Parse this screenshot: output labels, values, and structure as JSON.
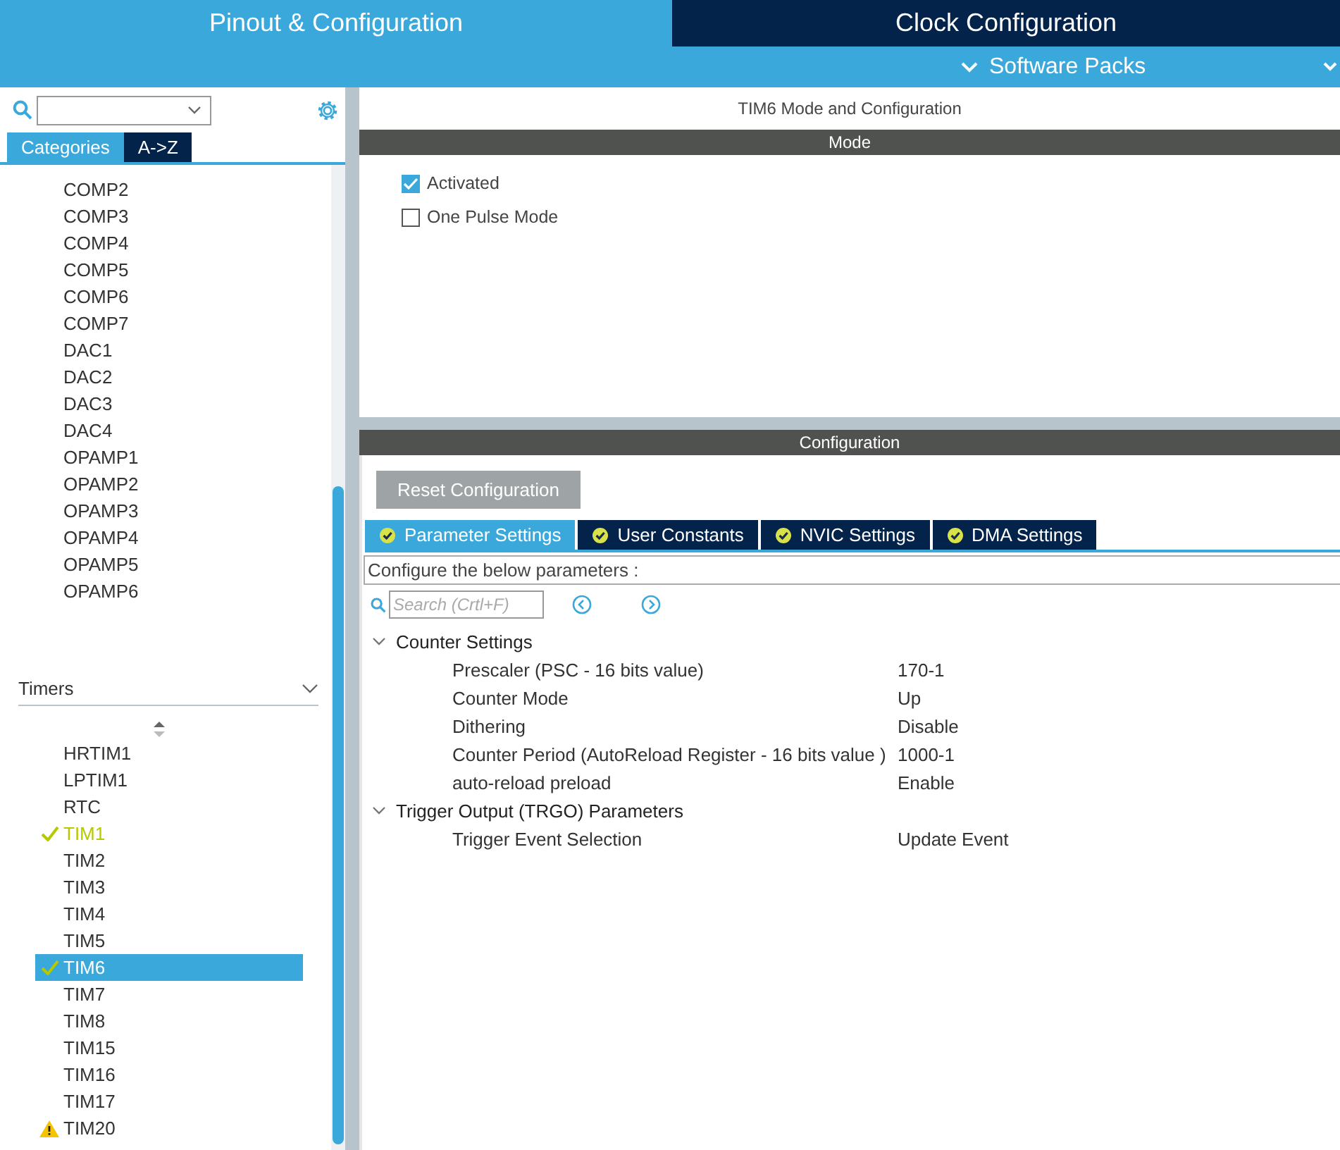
{
  "header": {
    "tabs": [
      {
        "label": "Pinout & Configuration",
        "selected": true
      },
      {
        "label": "Clock Configuration",
        "selected": false
      }
    ],
    "software_packs": "Software Packs"
  },
  "sidebar": {
    "view_tabs": [
      {
        "label": "Categories",
        "selected": true
      },
      {
        "label": "A->Z",
        "selected": false
      }
    ],
    "analog_items": [
      {
        "label": "COMP2",
        "configured": false,
        "warning": false,
        "selected": false
      },
      {
        "label": "COMP3",
        "configured": false,
        "warning": false,
        "selected": false
      },
      {
        "label": "COMP4",
        "configured": false,
        "warning": false,
        "selected": false
      },
      {
        "label": "COMP5",
        "configured": false,
        "warning": false,
        "selected": false
      },
      {
        "label": "COMP6",
        "configured": false,
        "warning": false,
        "selected": false
      },
      {
        "label": "COMP7",
        "configured": false,
        "warning": false,
        "selected": false
      },
      {
        "label": "DAC1",
        "configured": false,
        "warning": false,
        "selected": false
      },
      {
        "label": "DAC2",
        "configured": false,
        "warning": false,
        "selected": false
      },
      {
        "label": "DAC3",
        "configured": false,
        "warning": false,
        "selected": false
      },
      {
        "label": "DAC4",
        "configured": false,
        "warning": false,
        "selected": false
      },
      {
        "label": "OPAMP1",
        "configured": false,
        "warning": false,
        "selected": false
      },
      {
        "label": "OPAMP2",
        "configured": false,
        "warning": false,
        "selected": false
      },
      {
        "label": "OPAMP3",
        "configured": false,
        "warning": false,
        "selected": false
      },
      {
        "label": "OPAMP4",
        "configured": false,
        "warning": false,
        "selected": false
      },
      {
        "label": "OPAMP5",
        "configured": false,
        "warning": false,
        "selected": false
      },
      {
        "label": "OPAMP6",
        "configured": false,
        "warning": false,
        "selected": false
      }
    ],
    "timers_category": {
      "label": "Timers",
      "expanded": true
    },
    "timer_items": [
      {
        "label": "HRTIM1",
        "configured": false,
        "warning": false,
        "selected": false
      },
      {
        "label": "LPTIM1",
        "configured": false,
        "warning": false,
        "selected": false
      },
      {
        "label": "RTC",
        "configured": false,
        "warning": false,
        "selected": false
      },
      {
        "label": "TIM1",
        "configured": true,
        "warning": false,
        "selected": false
      },
      {
        "label": "TIM2",
        "configured": false,
        "warning": false,
        "selected": false
      },
      {
        "label": "TIM3",
        "configured": false,
        "warning": false,
        "selected": false
      },
      {
        "label": "TIM4",
        "configured": false,
        "warning": false,
        "selected": false
      },
      {
        "label": "TIM5",
        "configured": false,
        "warning": false,
        "selected": false
      },
      {
        "label": "TIM6",
        "configured": true,
        "warning": false,
        "selected": true
      },
      {
        "label": "TIM7",
        "configured": false,
        "warning": false,
        "selected": false
      },
      {
        "label": "TIM8",
        "configured": false,
        "warning": false,
        "selected": false
      },
      {
        "label": "TIM15",
        "configured": false,
        "warning": false,
        "selected": false
      },
      {
        "label": "TIM16",
        "configured": false,
        "warning": false,
        "selected": false
      },
      {
        "label": "TIM17",
        "configured": false,
        "warning": false,
        "selected": false
      },
      {
        "label": "TIM20",
        "configured": false,
        "warning": true,
        "selected": false
      }
    ]
  },
  "main": {
    "title": "TIM6 Mode and Configuration",
    "mode_bar": "Mode",
    "mode_options": [
      {
        "label": "Activated",
        "checked": true
      },
      {
        "label": "One Pulse Mode",
        "checked": false
      }
    ],
    "config_bar": "Configuration",
    "reset_button": "Reset Configuration",
    "tabs": [
      {
        "label": "Parameter Settings",
        "selected": true
      },
      {
        "label": "User Constants",
        "selected": false
      },
      {
        "label": "NVIC Settings",
        "selected": false
      },
      {
        "label": "DMA Settings",
        "selected": false
      }
    ],
    "hint": "Configure the below parameters :",
    "search": {
      "placeholder": "Search (Crtl+F)"
    },
    "groups": [
      {
        "label": "Counter Settings",
        "expanded": true,
        "params": [
          {
            "name": "Prescaler (PSC - 16 bits value)",
            "value": "170-1"
          },
          {
            "name": "Counter Mode",
            "value": "Up"
          },
          {
            "name": "Dithering",
            "value": "Disable"
          },
          {
            "name": "Counter Period (AutoReload Register - 16 bits value )",
            "value": "1000-1"
          },
          {
            "name": "auto-reload preload",
            "value": "Enable"
          }
        ]
      },
      {
        "label": "Trigger Output (TRGO) Parameters",
        "expanded": true,
        "params": [
          {
            "name": "Trigger Event Selection",
            "value": "Update Event"
          }
        ]
      }
    ]
  }
}
